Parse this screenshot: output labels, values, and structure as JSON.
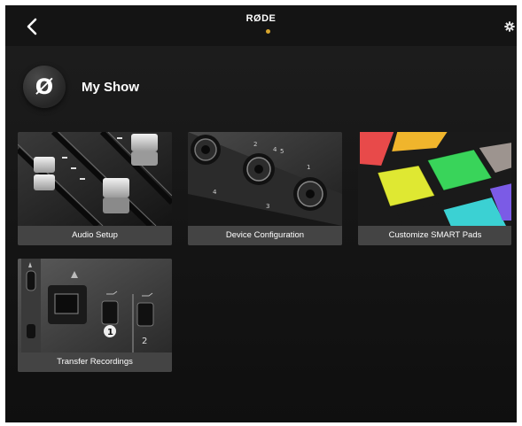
{
  "header": {
    "brand": "RØDE"
  },
  "show": {
    "avatar_glyph": "Ø",
    "title": "My Show"
  },
  "tiles": [
    {
      "label": "Audio Setup",
      "icon": "faders-image"
    },
    {
      "label": "Device Configuration",
      "icon": "xlr-inputs-image"
    },
    {
      "label": "Customize SMART Pads",
      "icon": "smart-pads-image"
    },
    {
      "label": "Transfer Recordings",
      "icon": "usb-ports-image"
    }
  ],
  "colors": {
    "background": "#1a1a1a",
    "accent": "#d7a52d",
    "label_bar": "#464646"
  },
  "port_labels": {
    "usb1": "1",
    "usb2": "2"
  }
}
